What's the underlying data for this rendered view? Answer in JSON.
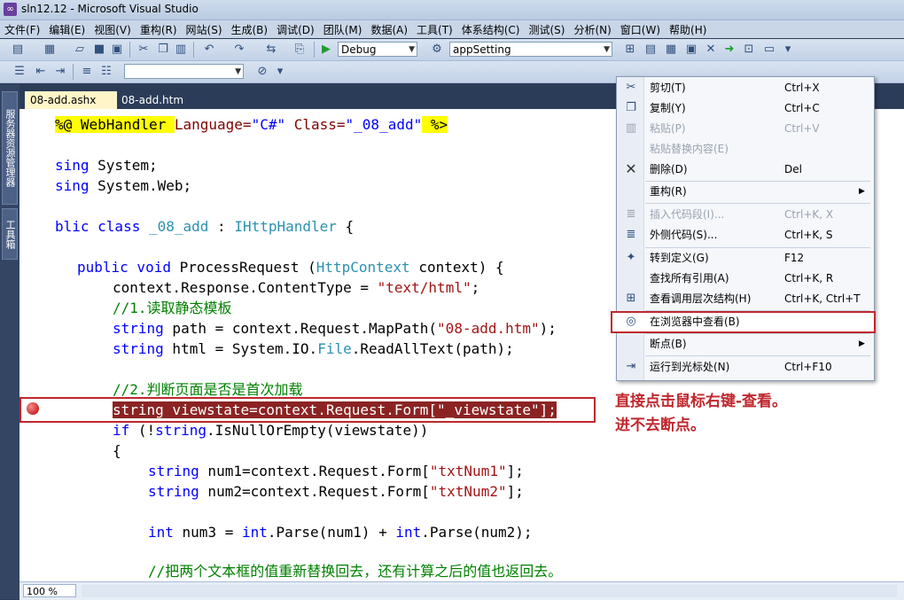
{
  "window": {
    "title": "sln12.12 - Microsoft Visual Studio"
  },
  "menubar": [
    "文件(F)",
    "编辑(E)",
    "视图(V)",
    "重构(R)",
    "网站(S)",
    "生成(B)",
    "调试(D)",
    "团队(M)",
    "数据(A)",
    "工具(T)",
    "体系结构(C)",
    "测试(S)",
    "分析(N)",
    "窗口(W)",
    "帮助(H)"
  ],
  "toolbar": {
    "config": "Debug",
    "project": "appSetting"
  },
  "sidebar": {
    "tab1": "服务器资源管理器",
    "tab2": "工具箱"
  },
  "tabs": [
    {
      "label": "08-add.ashx"
    },
    {
      "label": "08-add.htm"
    }
  ],
  "code": {
    "l1a": "%@ WebHandler ",
    "l1b": "Language=",
    "l1c": "\"C#\"",
    "l1d": " Class=",
    "l1e": "\"_08_add\"",
    "l1f": " %>",
    "l2a": "sing",
    "l2b": " System;",
    "l3a": "sing",
    "l3b": " System.Web;",
    "l4a": "blic class ",
    "l4b": "_08_add",
    "l4c": " : ",
    "l4d": "IHttpHandler",
    "l4e": " {",
    "l5a": "public void ",
    "l5b": "ProcessRequest (",
    "l5c": "HttpContext",
    "l5d": " context) {",
    "l6a": "context.Response.ContentType = ",
    "l6b": "\"text/html\"",
    "l6c": ";",
    "l7": "//1.读取静态模板",
    "l8a": "string",
    "l8b": " path = context.Request.MapPath(",
    "l8c": "\"08-add.htm\"",
    "l8d": ");",
    "l9a": "string",
    "l9b": " html = System.IO.",
    "l9c": "File",
    "l9d": ".ReadAllText(path);",
    "l10": "//2.判断页面是否是首次加载",
    "l11": "string viewstate=context.Request.Form[\"_viewstate\"];",
    "l12a": "if",
    "l12b": " (!",
    "l12c": "string",
    "l12d": ".IsNullOrEmpty(viewstate))",
    "l13": "{",
    "l14a": "string",
    "l14b": " num1=context.Request.Form[",
    "l14c": "\"txtNum1\"",
    "l14d": "];",
    "l15a": "string",
    "l15b": " num2=context.Request.Form[",
    "l15c": "\"txtNum2\"",
    "l15d": "];",
    "l16a": "int",
    "l16b": " num3 = ",
    "l16c": "int",
    "l16d": ".Parse(num1) + ",
    "l16e": "int",
    "l16f": ".Parse(num2);",
    "l17": "//把两个文本框的值重新替换回去，还有计算之后的值也返回去。"
  },
  "annotation": {
    "line1": "直接点击鼠标右键-查看。",
    "line2": "进不去断点。"
  },
  "context_menu": {
    "cut": {
      "label": "剪切(T)",
      "shortcut": "Ctrl+X"
    },
    "copy": {
      "label": "复制(Y)",
      "shortcut": "Ctrl+C"
    },
    "paste": {
      "label": "粘贴(P)",
      "shortcut": "Ctrl+V"
    },
    "paste_alt": {
      "label": "粘贴替换内容(E)"
    },
    "delete": {
      "label": "删除(D)",
      "shortcut": "Del"
    },
    "refactor": {
      "label": "重构(R)"
    },
    "insert_snippet": {
      "label": "插入代码段(I)...",
      "shortcut": "Ctrl+K, X"
    },
    "surround": {
      "label": "外侧代码(S)...",
      "shortcut": "Ctrl+K, S"
    },
    "goto_def": {
      "label": "转到定义(G)",
      "shortcut": "F12"
    },
    "find_refs": {
      "label": "查找所有引用(A)",
      "shortcut": "Ctrl+K, R"
    },
    "call_hierarchy": {
      "label": "查看调用层次结构(H)",
      "shortcut": "Ctrl+K, Ctrl+T"
    },
    "view_browser": {
      "label": "在浏览器中查看(B)"
    },
    "breakpoint": {
      "label": "断点(B)"
    },
    "run_cursor": {
      "label": "运行到光标处(N)",
      "shortcut": "Ctrl+F10"
    }
  },
  "status": {
    "zoom": "100 %"
  }
}
